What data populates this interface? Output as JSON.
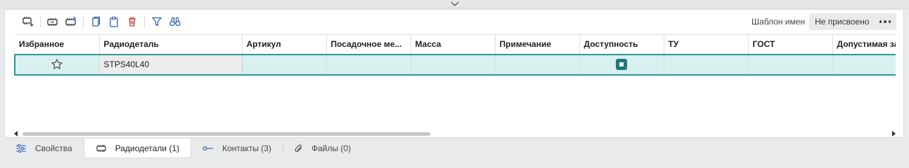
{
  "toolbar": {
    "buttons": [
      {
        "icon": "add-component-icon"
      },
      {
        "icon": "import-component-icon"
      },
      {
        "icon": "export-component-icon"
      },
      {
        "icon": "copy-icon"
      },
      {
        "icon": "paste-icon"
      },
      {
        "icon": "trash-icon"
      },
      {
        "icon": "filter-icon"
      },
      {
        "icon": "binoculars-icon"
      }
    ],
    "template_label": "Шаблон имен",
    "template_value": "Не присвоено"
  },
  "table": {
    "columns": [
      "Избранное",
      "Радиодеталь",
      "Артикул",
      "Посадочное ме...",
      "Масса",
      "Примечание",
      "Доступность",
      "ТУ",
      "ГОСТ",
      "Допустимая за"
    ],
    "rows": [
      {
        "favorite": false,
        "name": "STPS40L40",
        "article": "",
        "footprint": "",
        "mass": "",
        "note": "",
        "available": true,
        "tu": "",
        "gost": "",
        "tolerance": ""
      }
    ]
  },
  "tabs": [
    {
      "label": "Свойства",
      "icon": "sliders-icon",
      "active": false
    },
    {
      "label": "Радиодетали (1)",
      "icon": "component-icon",
      "active": true
    },
    {
      "label": "Контакты (3)",
      "icon": "contact-pin-icon",
      "active": false
    },
    {
      "label": "Файлы (0)",
      "icon": "paperclip-icon",
      "active": false
    }
  ],
  "colors": {
    "accent": "#2e9797",
    "selected_row": "#d8f0f0",
    "icon_blue": "#2d5fb0",
    "icon_red": "#c0392b",
    "icon_dark": "#333333"
  }
}
